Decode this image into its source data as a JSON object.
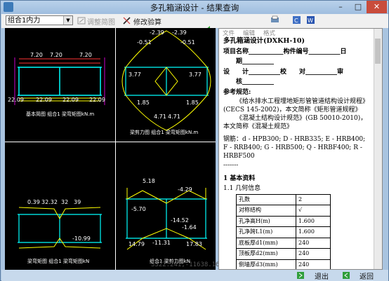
{
  "window": {
    "title": "多孔箱涵设计 - 结果查询",
    "min": "–",
    "max": "□",
    "close": "✕"
  },
  "toolbar": {
    "combo_value": "组合1内力",
    "adjust_label": "调整简图",
    "modify_label": "修改验算"
  },
  "diagrams": {
    "top_left": {
      "caption": "基本简图 组合1 梁弯矩图kN.m",
      "top_values": [
        "7.20",
        "7.20",
        "7.20"
      ],
      "bottom_values": [
        "22.09",
        "22.09",
        "22.09",
        "22.09"
      ]
    },
    "top_right": {
      "caption": "梁剪力图 组合1 梁弯矩图kN.m",
      "values": [
        "-2.39",
        "-2.39",
        "-0.51",
        "-0.51",
        "3.77",
        "3.77",
        "1.85",
        "1.85",
        "4.71",
        "4.71"
      ]
    },
    "bottom_left": {
      "caption": "梁弯矩图 组合1 梁弯矩图kN",
      "top_values": [
        "0.39",
        "32.32",
        "32",
        "39"
      ],
      "bottom_values": [
        "-10.99"
      ]
    },
    "bottom_right": {
      "caption": "组合1 梁剪力图kN",
      "values": [
        "5.18",
        "-4.29",
        "-5.70",
        "-14.52",
        "-1.64",
        "-11.31",
        "14.79",
        "17.83"
      ]
    }
  },
  "coords": "3322.241,-11638.164",
  "doc": {
    "menu": [
      "文件",
      "编辑",
      "格式"
    ],
    "title": "多孔箱涵设计(DXKH-10)",
    "line_project": "项目名称___________构件编号__________日",
    "line_date": "　　期__________",
    "line_sign": "设　　计__________校　　对__________审",
    "line_check": "　　核__________",
    "ref_head": "参考规范:",
    "ref1": "《给水排水工程埋地矩形管管道结构设计规程》(CECS 145-2002)，本文简称《矩形管道规程》",
    "ref2": "《混凝土结构设计规范》(GB 50010-2010)，本文简称《混凝土规范》",
    "rebar": "钢筋：d - HPB300; D - HRB335; E - HRB400; F - RRB400; G - HRB500; Q - HRBF400; R - HRBF500",
    "sep": "-------",
    "sec1": "1 基本资料",
    "sec11": "1.1 几何信息",
    "table": [
      [
        "孔数",
        "2"
      ],
      [
        "对称结构",
        "√"
      ],
      [
        "孔净高H(m)",
        "1.600"
      ],
      [
        "孔净跨L1(m)",
        "1.600"
      ],
      [
        "底板厚d1(mm)",
        "240"
      ],
      [
        "顶板厚d2(mm)",
        "240"
      ],
      [
        "侧墙厚d3(mm)",
        "240"
      ]
    ]
  },
  "bottom": {
    "exit_label": "退出",
    "back_label": "返回"
  },
  "colors": {
    "diagram_bg": "#000000",
    "frame": "#00ffff",
    "moment": "#ffff00",
    "axis": "#ff00ff"
  }
}
